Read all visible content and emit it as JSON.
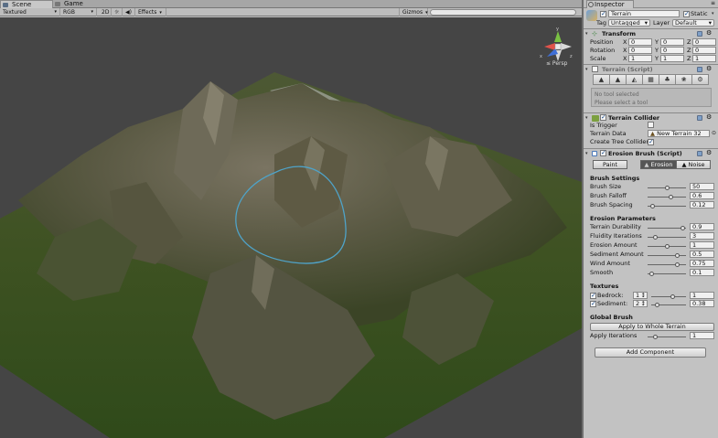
{
  "scene_tabs": [
    {
      "label": "Scene",
      "active": true
    },
    {
      "label": "Game",
      "active": false
    }
  ],
  "toolbar": {
    "shading": "Textured",
    "render_mode": "RGB",
    "mode2d": "2D",
    "light": "☼",
    "audio": "◀)",
    "effects": "Effects",
    "gizmos": "Gizmos"
  },
  "viewport": {
    "persp": "≤ Persp",
    "gizmo_axes": {
      "y": "y",
      "x": "x",
      "z": "z"
    }
  },
  "inspector": {
    "tab": "Inspector",
    "object": {
      "name": "Terrain",
      "static_label": "Static",
      "tag_label": "Tag",
      "tag": "Untagged",
      "layer_label": "Layer",
      "layer": "Default"
    },
    "transform": {
      "title": "Transform",
      "rows": [
        {
          "label": "Position",
          "x": "0",
          "y": "0",
          "z": "0"
        },
        {
          "label": "Rotation",
          "x": "0",
          "y": "0",
          "z": "0"
        },
        {
          "label": "Scale",
          "x": "1",
          "y": "1",
          "z": "1"
        }
      ],
      "axis_x": "X",
      "axis_y": "Y",
      "axis_z": "Z"
    },
    "terrain_script": {
      "title": "Terrain (Script)",
      "no_tool": "No tool selected",
      "select_tool": "Please select a tool"
    },
    "collider": {
      "title": "Terrain Collider",
      "is_trigger": "Is Trigger",
      "terrain_data_label": "Terrain Data",
      "terrain_data": "New Terrain 32",
      "create_trees": "Create Tree Collider"
    },
    "erosion": {
      "title": "Erosion Brush (Script)",
      "modes": [
        "Paint",
        "Erosion",
        "Noise"
      ],
      "brush_settings": "Brush Settings",
      "brush": [
        {
          "label": "Brush Size",
          "value": "50",
          "pos": 0.5
        },
        {
          "label": "Brush Falloff",
          "value": "0.6",
          "pos": 0.6
        },
        {
          "label": "Brush Spacing",
          "value": "0.12",
          "pos": 0.12
        }
      ],
      "erosion_params": "Erosion Parameters",
      "params": [
        {
          "label": "Terrain Durability",
          "value": "0.9",
          "pos": 0.9
        },
        {
          "label": "Fluidity Iterations",
          "value": "3",
          "pos": 0.2
        },
        {
          "label": "Erosion Amount",
          "value": "1",
          "pos": 0.5
        },
        {
          "label": "Sediment Amount",
          "value": "0.5",
          "pos": 0.75
        },
        {
          "label": "Wind Amount",
          "value": "0.75",
          "pos": 0.75
        },
        {
          "label": "Smooth",
          "value": "0.1",
          "pos": 0.1
        }
      ],
      "textures": "Textures",
      "bedrock": {
        "label": "Bedrock:",
        "channel": "1",
        "value": "1",
        "pos": 0.6
      },
      "sediment": {
        "label": "Sediment:",
        "channel": "2",
        "value": "0.38",
        "pos": 0.15
      },
      "global_brush": "Global Brush",
      "apply_whole": "Apply to Whole Terrain",
      "apply_iter_label": "Apply Iterations",
      "apply_iter": "1",
      "apply_iter_pos": 0.0
    },
    "add_component": "Add Component"
  }
}
